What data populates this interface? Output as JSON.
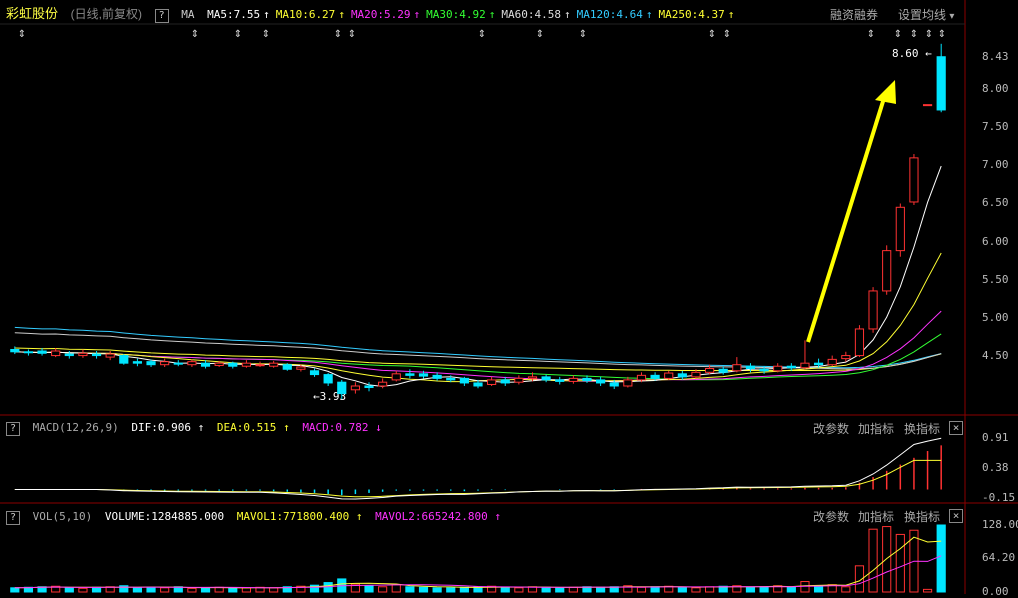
{
  "header": {
    "stock_name": "彩虹股份",
    "mode": "(日线,前复权)",
    "help": "?",
    "ma_label": "MA",
    "ma_items": [
      {
        "text": "MA5:7.55",
        "color": "#ffffff"
      },
      {
        "text": "MA10:6.27",
        "color": "#ffff33"
      },
      {
        "text": "MA20:5.29",
        "color": "#ff33ff"
      },
      {
        "text": "MA30:4.92",
        "color": "#33ff33"
      },
      {
        "text": "MA60:4.58",
        "color": "#dddddd"
      },
      {
        "text": "MA120:4.64",
        "color": "#33ccff"
      },
      {
        "text": "MA250:4.37",
        "color": "#ffff33"
      }
    ],
    "arrow_glyph": "↑",
    "margin_trading": "融资融券",
    "set_ma": "设置均线",
    "dropdown_glyph": "▾"
  },
  "price_axis": [
    "8.43",
    "8.00",
    "7.50",
    "7.00",
    "6.50",
    "6.00",
    "5.50",
    "5.00",
    "4.50"
  ],
  "annotations": {
    "high": "8.60",
    "low": "3.93",
    "high_arrow": "←",
    "low_arrow": "←"
  },
  "macd": {
    "label": "MACD(12,26,9)",
    "dif": "DIF:0.906",
    "dea": "DEA:0.515",
    "macd": "MACD:0.782",
    "up": "↑",
    "down": "↓",
    "axis": [
      "0.91",
      "0.38",
      "-0.15"
    ],
    "buttons": {
      "params": "改参数",
      "add": "加指标",
      "switch": "换指标"
    },
    "close": "×"
  },
  "vol": {
    "label": "VOL(5,10)",
    "volume": "VOLUME:1284885.000",
    "mavol1": "MAVOL1:771800.400",
    "mavol2": "MAVOL2:665242.800",
    "up": "↑",
    "axis": [
      "128.00",
      "64.20",
      "0.00"
    ],
    "buttons": {
      "params": "改参数",
      "add": "加指标",
      "switch": "换指标"
    },
    "close": "×"
  },
  "colors": {
    "up": "#ff3232",
    "down": "#00e5ff",
    "ma5": "#ffffff",
    "ma10": "#ffff33",
    "ma20": "#ff33ff",
    "ma30": "#33ff33",
    "ma60": "#cccccc",
    "ma120": "#33ccff",
    "ma250": "#ffff33",
    "arrow": "#ffff00",
    "frame": "#8b0000"
  },
  "chart_data": {
    "type": "candlestick",
    "y_range": [
      3.85,
      8.65
    ],
    "candles": [
      [
        4.58,
        4.55,
        4.62,
        4.52
      ],
      [
        4.55,
        4.54,
        4.58,
        4.5
      ],
      [
        4.56,
        4.53,
        4.6,
        4.5
      ],
      [
        4.5,
        4.56,
        4.6,
        4.48
      ],
      [
        4.52,
        4.5,
        4.56,
        4.46
      ],
      [
        4.5,
        4.53,
        4.58,
        4.47
      ],
      [
        4.52,
        4.5,
        4.56,
        4.46
      ],
      [
        4.48,
        4.52,
        4.56,
        4.44
      ],
      [
        4.5,
        4.4,
        4.52,
        4.38
      ],
      [
        4.42,
        4.4,
        4.46,
        4.36
      ],
      [
        4.42,
        4.38,
        4.45,
        4.35
      ],
      [
        4.38,
        4.42,
        4.46,
        4.35
      ],
      [
        4.4,
        4.39,
        4.44,
        4.36
      ],
      [
        4.38,
        4.42,
        4.45,
        4.35
      ],
      [
        4.4,
        4.36,
        4.44,
        4.33
      ],
      [
        4.37,
        4.4,
        4.43,
        4.35
      ],
      [
        4.4,
        4.36,
        4.42,
        4.33
      ],
      [
        4.36,
        4.4,
        4.44,
        4.34
      ],
      [
        4.38,
        4.38,
        4.42,
        4.35
      ],
      [
        4.36,
        4.4,
        4.43,
        4.34
      ],
      [
        4.38,
        4.32,
        4.4,
        4.3
      ],
      [
        4.32,
        4.35,
        4.38,
        4.29
      ],
      [
        4.3,
        4.25,
        4.33,
        4.22
      ],
      [
        4.25,
        4.14,
        4.27,
        4.1
      ],
      [
        4.15,
        4.0,
        4.18,
        3.93
      ],
      [
        4.05,
        4.1,
        4.15,
        4.0
      ],
      [
        4.1,
        4.08,
        4.15,
        4.03
      ],
      [
        4.1,
        4.15,
        4.2,
        4.07
      ],
      [
        4.18,
        4.26,
        4.3,
        4.16
      ],
      [
        4.26,
        4.24,
        4.32,
        4.2
      ],
      [
        4.26,
        4.23,
        4.3,
        4.2
      ],
      [
        4.24,
        4.2,
        4.28,
        4.17
      ],
      [
        4.2,
        4.18,
        4.24,
        4.15
      ],
      [
        4.2,
        4.14,
        4.22,
        4.1
      ],
      [
        4.14,
        4.1,
        4.18,
        4.07
      ],
      [
        4.12,
        4.18,
        4.22,
        4.1
      ],
      [
        4.18,
        4.14,
        4.22,
        4.1
      ],
      [
        4.15,
        4.2,
        4.24,
        4.12
      ],
      [
        4.2,
        4.22,
        4.28,
        4.16
      ],
      [
        4.22,
        4.18,
        4.25,
        4.15
      ],
      [
        4.18,
        4.16,
        4.22,
        4.12
      ],
      [
        4.16,
        4.2,
        4.24,
        4.13
      ],
      [
        4.2,
        4.17,
        4.24,
        4.14
      ],
      [
        4.18,
        4.14,
        4.22,
        4.1
      ],
      [
        4.14,
        4.1,
        4.18,
        4.06
      ],
      [
        4.1,
        4.18,
        4.22,
        4.08
      ],
      [
        4.18,
        4.24,
        4.28,
        4.15
      ],
      [
        4.24,
        4.2,
        4.28,
        4.17
      ],
      [
        4.2,
        4.27,
        4.3,
        4.18
      ],
      [
        4.26,
        4.22,
        4.3,
        4.18
      ],
      [
        4.22,
        4.28,
        4.32,
        4.2
      ],
      [
        4.28,
        4.33,
        4.38,
        4.25
      ],
      [
        4.32,
        4.28,
        4.36,
        4.25
      ],
      [
        4.3,
        4.38,
        4.48,
        4.28
      ],
      [
        4.36,
        4.33,
        4.4,
        4.28
      ],
      [
        4.32,
        4.3,
        4.36,
        4.26
      ],
      [
        4.3,
        4.36,
        4.4,
        4.28
      ],
      [
        4.36,
        4.34,
        4.4,
        4.3
      ],
      [
        4.34,
        4.4,
        4.7,
        4.32
      ],
      [
        4.4,
        4.38,
        4.46,
        4.34
      ],
      [
        4.38,
        4.45,
        4.5,
        4.36
      ],
      [
        4.46,
        4.5,
        4.55,
        4.42
      ],
      [
        4.5,
        4.85,
        4.9,
        4.48
      ],
      [
        4.85,
        5.35,
        5.4,
        4.8
      ],
      [
        5.35,
        5.88,
        5.95,
        5.3
      ],
      [
        5.88,
        6.45,
        6.5,
        5.8
      ],
      [
        6.52,
        7.1,
        7.15,
        6.48
      ],
      [
        7.8,
        7.8,
        7.8,
        7.8
      ],
      [
        8.43,
        7.73,
        8.6,
        7.7
      ]
    ],
    "volume": [
      8,
      9,
      10,
      11,
      8,
      7,
      9,
      10,
      12,
      8,
      9,
      8,
      10,
      7,
      8,
      9,
      7,
      8,
      9,
      8,
      10,
      11,
      13,
      18,
      25,
      15,
      12,
      10,
      14,
      10,
      9,
      8,
      8,
      9,
      10,
      11,
      9,
      8,
      10,
      9,
      8,
      9,
      10,
      9,
      10,
      12,
      9,
      10,
      11,
      9,
      8,
      10,
      11,
      12,
      9,
      10,
      12,
      9,
      20,
      12,
      14,
      10,
      50,
      120,
      125,
      110,
      118,
      5,
      128
    ],
    "macd_hist": [
      0.0,
      0.0,
      0.0,
      0.0,
      0.0,
      0.0,
      0.0,
      -0.01,
      -0.02,
      -0.02,
      -0.02,
      -0.02,
      -0.02,
      -0.02,
      -0.02,
      -0.02,
      -0.02,
      -0.02,
      -0.02,
      -0.03,
      -0.04,
      -0.05,
      -0.06,
      -0.08,
      -0.1,
      -0.08,
      -0.06,
      -0.04,
      -0.02,
      -0.02,
      -0.02,
      -0.02,
      -0.02,
      -0.03,
      -0.02,
      -0.01,
      -0.01,
      0.0,
      0.0,
      0.0,
      -0.01,
      0.0,
      0.0,
      -0.01,
      -0.01,
      0.0,
      0.01,
      0.01,
      0.01,
      0.01,
      0.01,
      0.02,
      0.02,
      0.03,
      0.02,
      0.02,
      0.02,
      0.02,
      0.03,
      0.03,
      0.03,
      0.04,
      0.12,
      0.22,
      0.33,
      0.44,
      0.56,
      0.68,
      0.78
    ]
  }
}
